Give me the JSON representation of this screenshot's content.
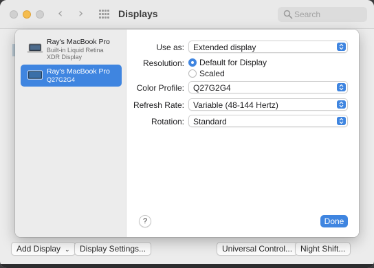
{
  "window": {
    "title": "Displays",
    "back_glyph": "‹",
    "forward_glyph": "›",
    "search_placeholder": "Search"
  },
  "sidebar": {
    "displays": [
      {
        "name": "Ray's MacBook Pro",
        "sub1": "Built-in Liquid Retina",
        "sub2": "XDR Display",
        "selected": false
      },
      {
        "name": "Ray's MacBook Pro",
        "sub1": "Q27G2G4",
        "selected": true
      }
    ]
  },
  "settings": {
    "use_as_label": "Use as:",
    "use_as_value": "Extended display",
    "resolution_label": "Resolution:",
    "resolution_options": [
      "Default for Display",
      "Scaled"
    ],
    "resolution_selected": "Default for Display",
    "color_profile_label": "Color Profile:",
    "color_profile_value": "Q27G2G4",
    "refresh_rate_label": "Refresh Rate:",
    "refresh_rate_value": "Variable (48-144 Hertz)",
    "rotation_label": "Rotation:",
    "rotation_value": "Standard"
  },
  "sheet_buttons": {
    "help": "?",
    "done": "Done"
  },
  "bottom_bar": {
    "add_display": "Add Display",
    "display_settings": "Display Settings...",
    "universal_control": "Universal Control...",
    "night_shift": "Night Shift..."
  },
  "colors": {
    "accent": "#3f85e0",
    "minimize": "#f5bd4f"
  }
}
